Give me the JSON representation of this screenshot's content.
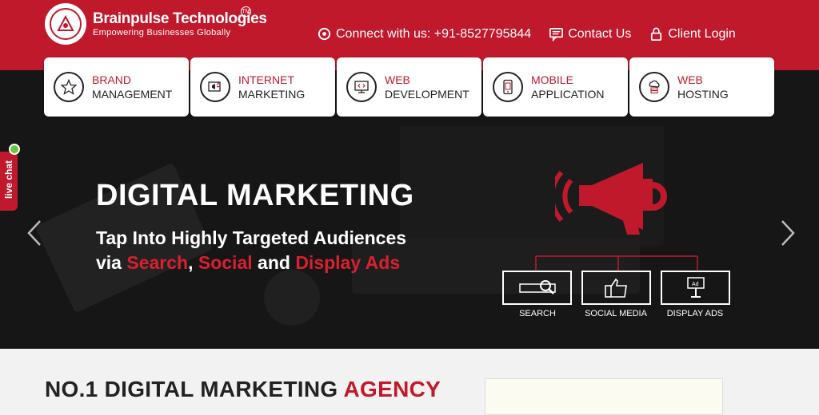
{
  "brand": {
    "name": "Brainpulse Technologies",
    "tagline": "Empowering Businesses Globally",
    "tm": "TM"
  },
  "topnav": {
    "connect": "Connect with us: +91-8527795844",
    "contact": "Contact Us",
    "login": "Client Login"
  },
  "services": [
    {
      "top": "BRAND",
      "bottom": "MANAGEMENT",
      "icon": "star-icon"
    },
    {
      "top": "INTERNET",
      "bottom": "MARKETING",
      "icon": "megaphone-screen-icon"
    },
    {
      "top": "WEB",
      "bottom": "DEVELOPMENT",
      "icon": "code-monitor-icon"
    },
    {
      "top": "MOBILE",
      "bottom": "APPLICATION",
      "icon": "mobile-icon"
    },
    {
      "top": "WEB",
      "bottom": "HOSTING",
      "icon": "cloud-server-icon"
    }
  ],
  "hero": {
    "title": "DIGITAL MARKETING",
    "line1": "Tap Into Highly Targeted Audiences",
    "line2_pre": "via ",
    "search": "Search",
    "comma": ", ",
    "social": "Social",
    "and": " and ",
    "display": "Display Ads",
    "features": [
      "SEARCH",
      "SOCIAL MEDIA",
      "DISPLAY ADS"
    ],
    "ad_label": "Ad"
  },
  "livechat": "live chat",
  "section": {
    "heading_main": "NO.1 DIGITAL MARKETING ",
    "heading_accent": "AGENCY"
  },
  "colors": {
    "brand_red": "#c0192c",
    "dark": "#161616",
    "online_green": "#6cc63b"
  }
}
